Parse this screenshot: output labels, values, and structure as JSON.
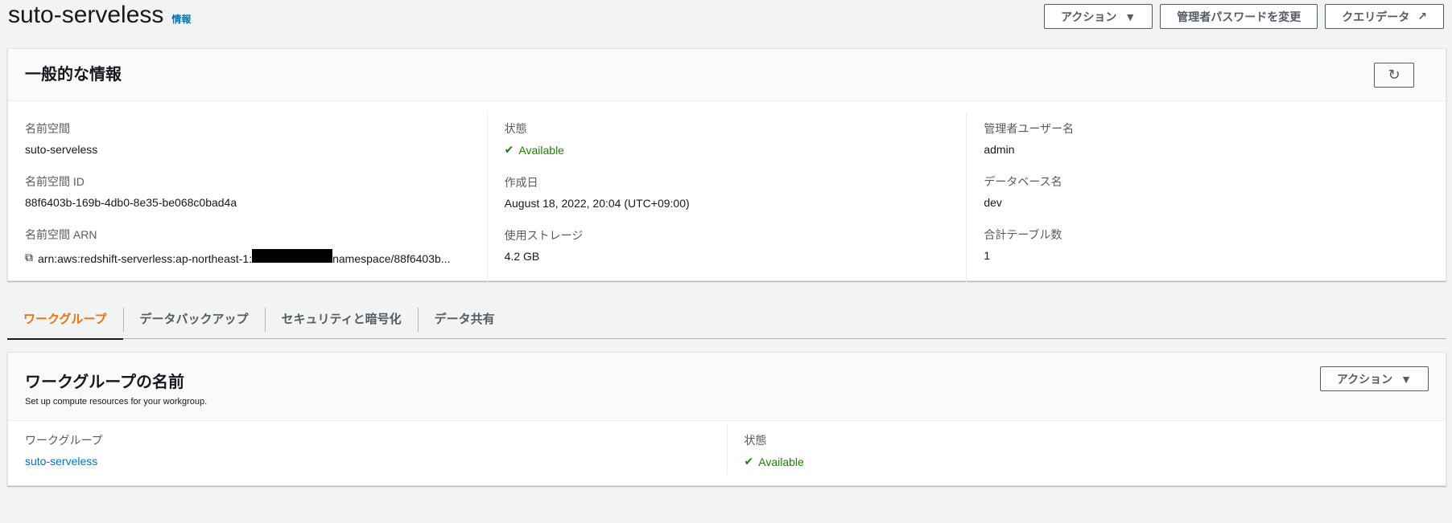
{
  "header": {
    "title": "suto-serveless",
    "info": "情報",
    "actions": "アクション",
    "change_password": "管理者パスワードを変更",
    "query_data": "クエリデータ"
  },
  "general": {
    "title": "一般的な情報",
    "namespace_label": "名前空間",
    "namespace": "suto-serveless",
    "namespace_id_label": "名前空間 ID",
    "namespace_id": "88f6403b-169b-4db0-8e35-be068c0bad4a",
    "arn_label": "名前空間 ARN",
    "arn_prefix": "arn:aws:redshift-serverless:ap-northeast-1:",
    "arn_suffix": "namespace/88f6403b...",
    "status_label": "状態",
    "status": "Available",
    "created_label": "作成日",
    "created": "August 18, 2022, 20:04 (UTC+09:00)",
    "storage_label": "使用ストレージ",
    "storage": "4.2 GB",
    "admin_label": "管理者ユーザー名",
    "admin": "admin",
    "db_label": "データベース名",
    "db": "dev",
    "tables_label": "合計テーブル数",
    "tables": "1"
  },
  "tabs": [
    "ワークグループ",
    "データバックアップ",
    "セキュリティと暗号化",
    "データ共有"
  ],
  "workgroup": {
    "title": "ワークグループの名前",
    "subtitle": "Set up compute resources for your workgroup.",
    "actions": "アクション",
    "wg_label": "ワークグループ",
    "wg": "suto-serveless",
    "status_label": "状態",
    "status": "Available"
  }
}
